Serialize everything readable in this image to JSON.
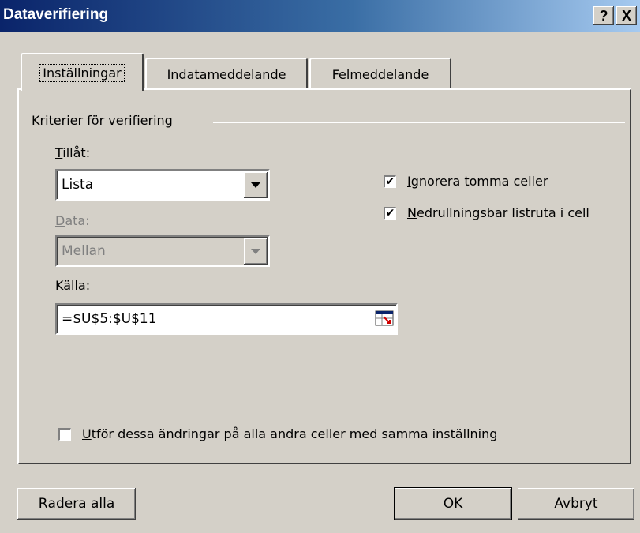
{
  "window": {
    "title": "Dataverifiering",
    "help_label": "?",
    "close_label": "X"
  },
  "tabs": [
    {
      "label": "Inställningar",
      "active": true
    },
    {
      "label": "Indatameddelande",
      "active": false
    },
    {
      "label": "Felmeddelande",
      "active": false
    }
  ],
  "criteria": {
    "group_label": "Kriterier för verifiering",
    "allow": {
      "label_underlined": "T",
      "label_rest": "illåt:",
      "value": "Lista"
    },
    "data": {
      "label_underlined": "D",
      "label_rest": "ata:",
      "value": "Mellan",
      "disabled": true
    },
    "source": {
      "label_underlined": "K",
      "label_rest": "älla:",
      "value": "=$U$5:$U$11"
    },
    "ignore_blank": {
      "label_underlined": "I",
      "label_rest": "gnorera tomma celler",
      "checked": true
    },
    "in_cell_dropdown": {
      "label_underlined": "N",
      "label_rest": "edrullningsbar listruta i cell",
      "checked": true
    }
  },
  "apply_all": {
    "label_underlined": "U",
    "label_rest": "tför dessa ändringar på alla andra celler med samma inställning",
    "checked": false
  },
  "buttons": {
    "clear_all_pre": "R",
    "clear_all_underlined": "a",
    "clear_all_post": "dera alla",
    "ok": "OK",
    "cancel": "Avbryt"
  },
  "colors": {
    "title_start": "#0a246a",
    "title_end": "#a6caf0",
    "face": "#d4d0c8"
  }
}
